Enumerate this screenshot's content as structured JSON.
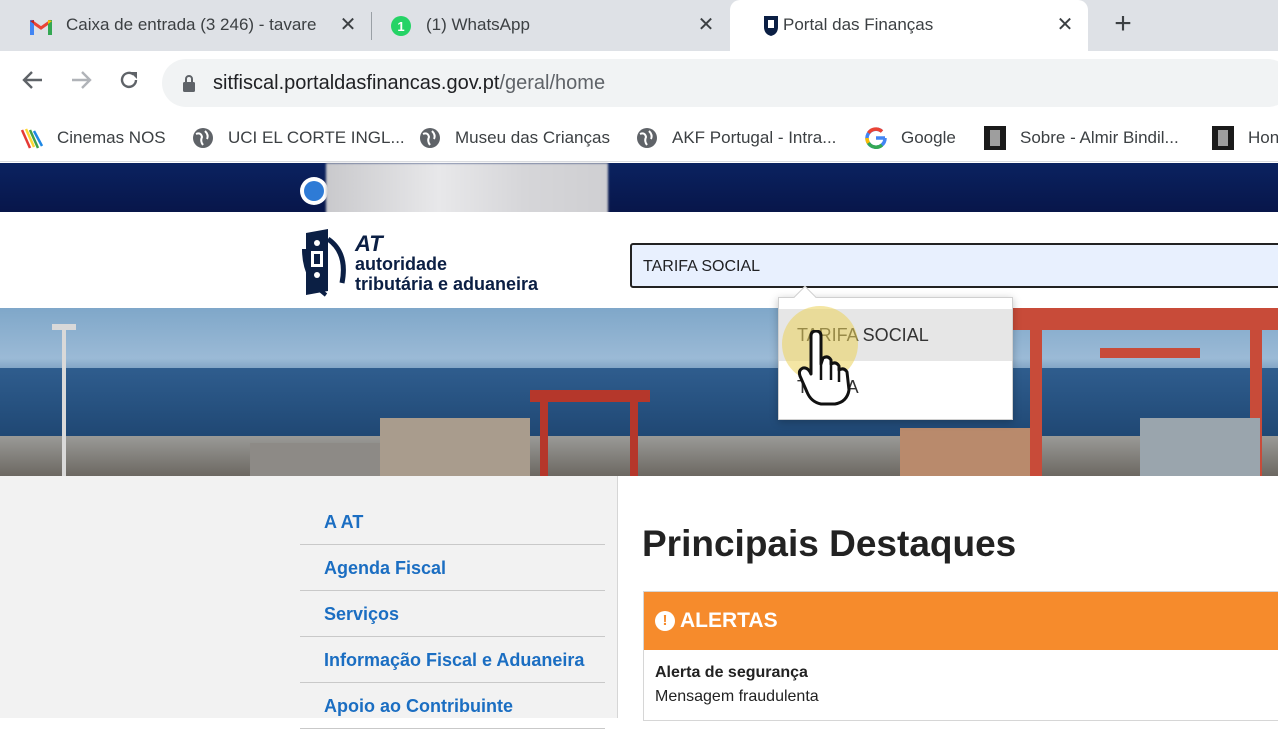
{
  "browser": {
    "tabs": [
      {
        "title": "Caixa de entrada (3 246) - tavare",
        "icon": "gmail-icon"
      },
      {
        "title": "(1) WhatsApp",
        "icon": "whatsapp-icon"
      },
      {
        "title": "Portal das Finanças",
        "icon": "at-portal-icon",
        "active": true
      }
    ],
    "close_glyph": "✕",
    "new_tab_glyph": "+",
    "url_host": "sitfiscal.portaldasfinancas.gov.pt",
    "url_path": "/geral/home",
    "bookmarks": [
      {
        "label": "Cinemas NOS",
        "icon": "nos-icon"
      },
      {
        "label": "UCI EL CORTE INGL...",
        "icon": "globe-icon"
      },
      {
        "label": "Museu das Crianças",
        "icon": "globe-icon"
      },
      {
        "label": "AKF Portugal - Intra...",
        "icon": "globe-icon"
      },
      {
        "label": "Google",
        "icon": "google-icon"
      },
      {
        "label": "Sobre - Almir Bindil...",
        "icon": "bookmark-page-icon"
      },
      {
        "label": "Hon",
        "icon": "bookmark-page-icon"
      }
    ]
  },
  "site": {
    "logo": {
      "line1": "AT",
      "line2": "autoridade",
      "line3": "tributária e aduaneira"
    },
    "search_value": "TARIFA SOCIAL",
    "suggestions": [
      "TARIFA SOCIAL",
      "TARIFA"
    ],
    "menu": [
      "A AT",
      "Agenda Fiscal",
      "Serviços",
      "Informação Fiscal e Aduaneira",
      "Apoio ao Contribuinte"
    ],
    "heading": "Principais Destaques",
    "alert": {
      "title": "ALERTAS",
      "icon_glyph": "!",
      "item_title": "Alerta de segurança",
      "item_text": "Mensagem fraudulenta"
    },
    "colors": {
      "navy": "#0a2260",
      "link": "#1b6ec2",
      "alert_orange": "#f68b2c"
    }
  }
}
